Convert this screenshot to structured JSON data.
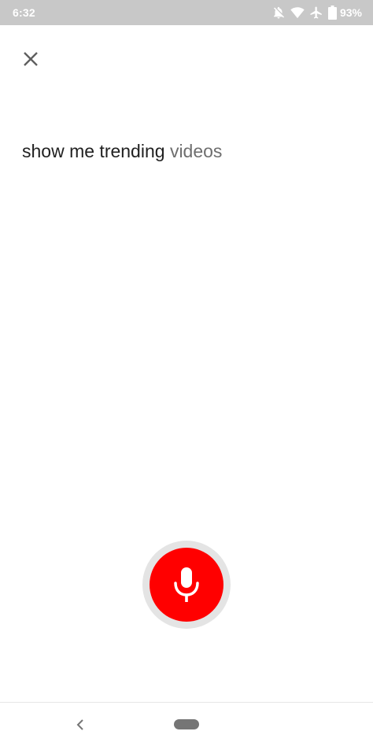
{
  "status_bar": {
    "time": "6:32",
    "battery_percent": "93%",
    "icons": [
      "notifications-off-icon",
      "wifi-icon",
      "airplane-mode-icon",
      "battery-icon"
    ]
  },
  "header": {
    "close_icon": "close-icon"
  },
  "voice_search": {
    "transcript_final": "show me trending",
    "transcript_pending": "videos"
  },
  "mic": {
    "icon": "microphone-icon",
    "color": "#ff0000"
  },
  "nav_bar": {
    "back_icon": "back-icon",
    "home_icon": "home-pill-icon"
  }
}
